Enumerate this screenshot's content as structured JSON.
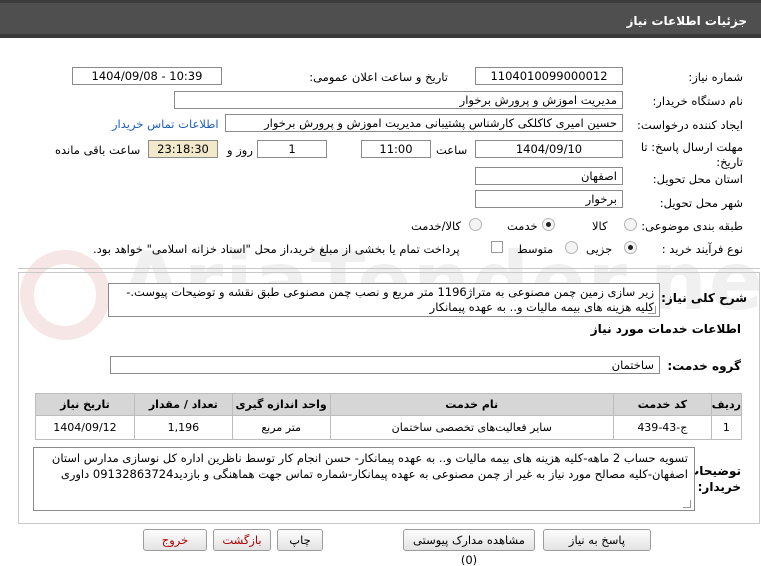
{
  "header": {
    "title": "جزئیات اطلاعات نیاز"
  },
  "form": {
    "need_number_label": "شماره نیاز:",
    "need_number": "1104010099000012",
    "announce_label": "تاریخ و ساعت اعلان عمومی:",
    "announce_value": "1404/09/08 - 10:39",
    "buyer_org_label": "نام دستگاه خریدار:",
    "buyer_org": "مدیریت اموزش و پرورش برخوار",
    "creator_label": "ایجاد کننده درخواست:",
    "creator": "حسین امیری کاکلکی کارشناس پشتیبانی مدیریت اموزش و پرورش برخوار",
    "contact_link": "اطلاعات تماس خریدار",
    "deadline_label": "مهلت ارسال پاسخ: تا تاریخ:",
    "deadline_date": "1404/09/10",
    "time_label": "ساعت",
    "deadline_time": "11:00",
    "days_value": "1",
    "days_label": "روز و",
    "remaining_time": "23:18:30",
    "remaining_label": "ساعت باقی مانده",
    "province_label": "استان محل تحویل:",
    "province": "اصفهان",
    "city_label": "شهر محل تحویل:",
    "city": "برخوار",
    "category_label": "طبقه بندی موضوعی:",
    "category_options": [
      "کالا",
      "خدمت",
      "کالا/خدمت"
    ],
    "process_label": "نوع فرآیند خرید :",
    "process_options": [
      "جزیی",
      "متوسط"
    ],
    "payment_note": "پرداخت تمام یا بخشی از مبلغ خرید،از محل \"اسناد خزانه اسلامی\" خواهد بود."
  },
  "description": {
    "label": "شرح کلی نیاز:",
    "text": "زیر سازی زمین چمن مصنوعی به متراژ1196 متر مربع و نصب چمن مصنوعی طبق نقشه و توضیحات پیوست.-کلیه هزینه های بیمه مالیات و.. به عهده پیمانکار"
  },
  "services": {
    "section_title": "اطلاعات خدمات مورد نیاز",
    "group_label": "گروه خدمت:",
    "group_value": "ساختمان",
    "columns": [
      "ردیف",
      "کد خدمت",
      "نام خدمت",
      "واحد اندازه گیری",
      "تعداد / مقدار",
      "تاریخ نیاز"
    ],
    "rows": [
      [
        "1",
        "ج-43-439",
        "سایر فعالیت‌های تخصصی ساختمان",
        "متر مربع",
        "1,196",
        "1404/09/12"
      ]
    ]
  },
  "buyer_notes": {
    "label": "توضیحات خریدار:",
    "text": "تسویه حساب 2 ماهه-کلیه هزینه های بیمه مالیات و.. به عهده پیمانکار- حسن انجام کار توسط ناظرین اداره کل نوسازی مدارس استان اصفهان-کلیه مصالح مورد نیاز به غیر از چمن مصنوعی به عهده پیمانکار-شماره تماس جهت هماهنگی و بازدید09132863724 داوری"
  },
  "buttons": {
    "reply": "پاسخ به نیاز",
    "docs": "مشاهده مدارک پیوستی (0)",
    "print": "چاپ",
    "back": "بازگشت",
    "exit": "خروج"
  }
}
